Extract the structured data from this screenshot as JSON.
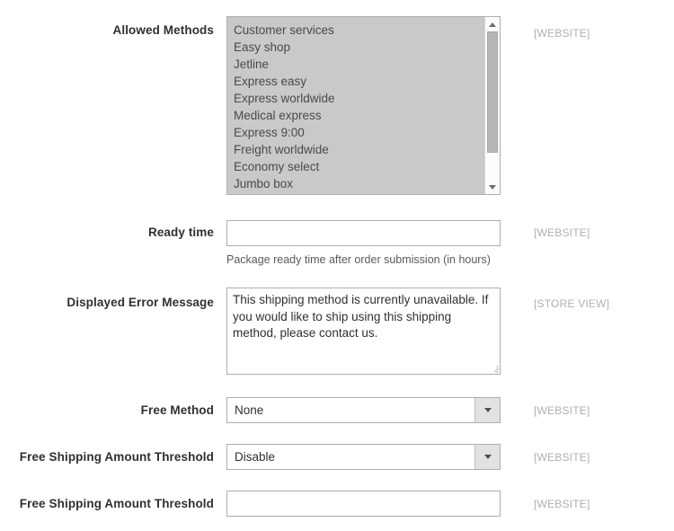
{
  "form": {
    "rows": [
      {
        "id": "allowed-methods",
        "label": "Allowed Methods",
        "scope": "[WEBSITE]",
        "type": "multiselect",
        "options": [
          "Customer services",
          "Easy shop",
          "Jetline",
          "Express easy",
          "Express worldwide",
          "Medical express",
          "Express 9:00",
          "Freight worldwide",
          "Economy select",
          "Jumbo box"
        ]
      },
      {
        "id": "ready-time",
        "label": "Ready time",
        "scope": "[WEBSITE]",
        "type": "text",
        "value": "",
        "placeholder": "",
        "hint": "Package ready time after order submission (in hours)"
      },
      {
        "id": "displayed-error-message",
        "label": "Displayed Error Message",
        "scope": "[STORE VIEW]",
        "type": "textarea",
        "value": "This shipping method is currently unavailable. If you would like to ship using this shipping method, please contact us."
      },
      {
        "id": "free-method",
        "label": "Free Method",
        "scope": "[WEBSITE]",
        "type": "select",
        "value": "None"
      },
      {
        "id": "free-shipping-amount-threshold-enable",
        "label": "Free Shipping Amount Threshold",
        "scope": "[WEBSITE]",
        "type": "select",
        "value": "Disable"
      },
      {
        "id": "free-shipping-amount-threshold-value",
        "label": "Free Shipping Amount Threshold",
        "scope": "[WEBSITE]",
        "type": "text",
        "value": "",
        "placeholder": ""
      }
    ]
  },
  "icons": {
    "scroll_up": "triangle-up-icon",
    "scroll_down": "triangle-down-icon",
    "dropdown": "chevron-down-icon",
    "resize": "resize-grip-icon"
  },
  "colors": {
    "page_background": "#ffffff",
    "border": "#adadad",
    "multiselect_background": "#c9c9c9",
    "label_text": "#303030",
    "scope_text": "#b0b0b0",
    "hint_text": "#5a5a5a",
    "select_button": "#e2e2e2"
  }
}
